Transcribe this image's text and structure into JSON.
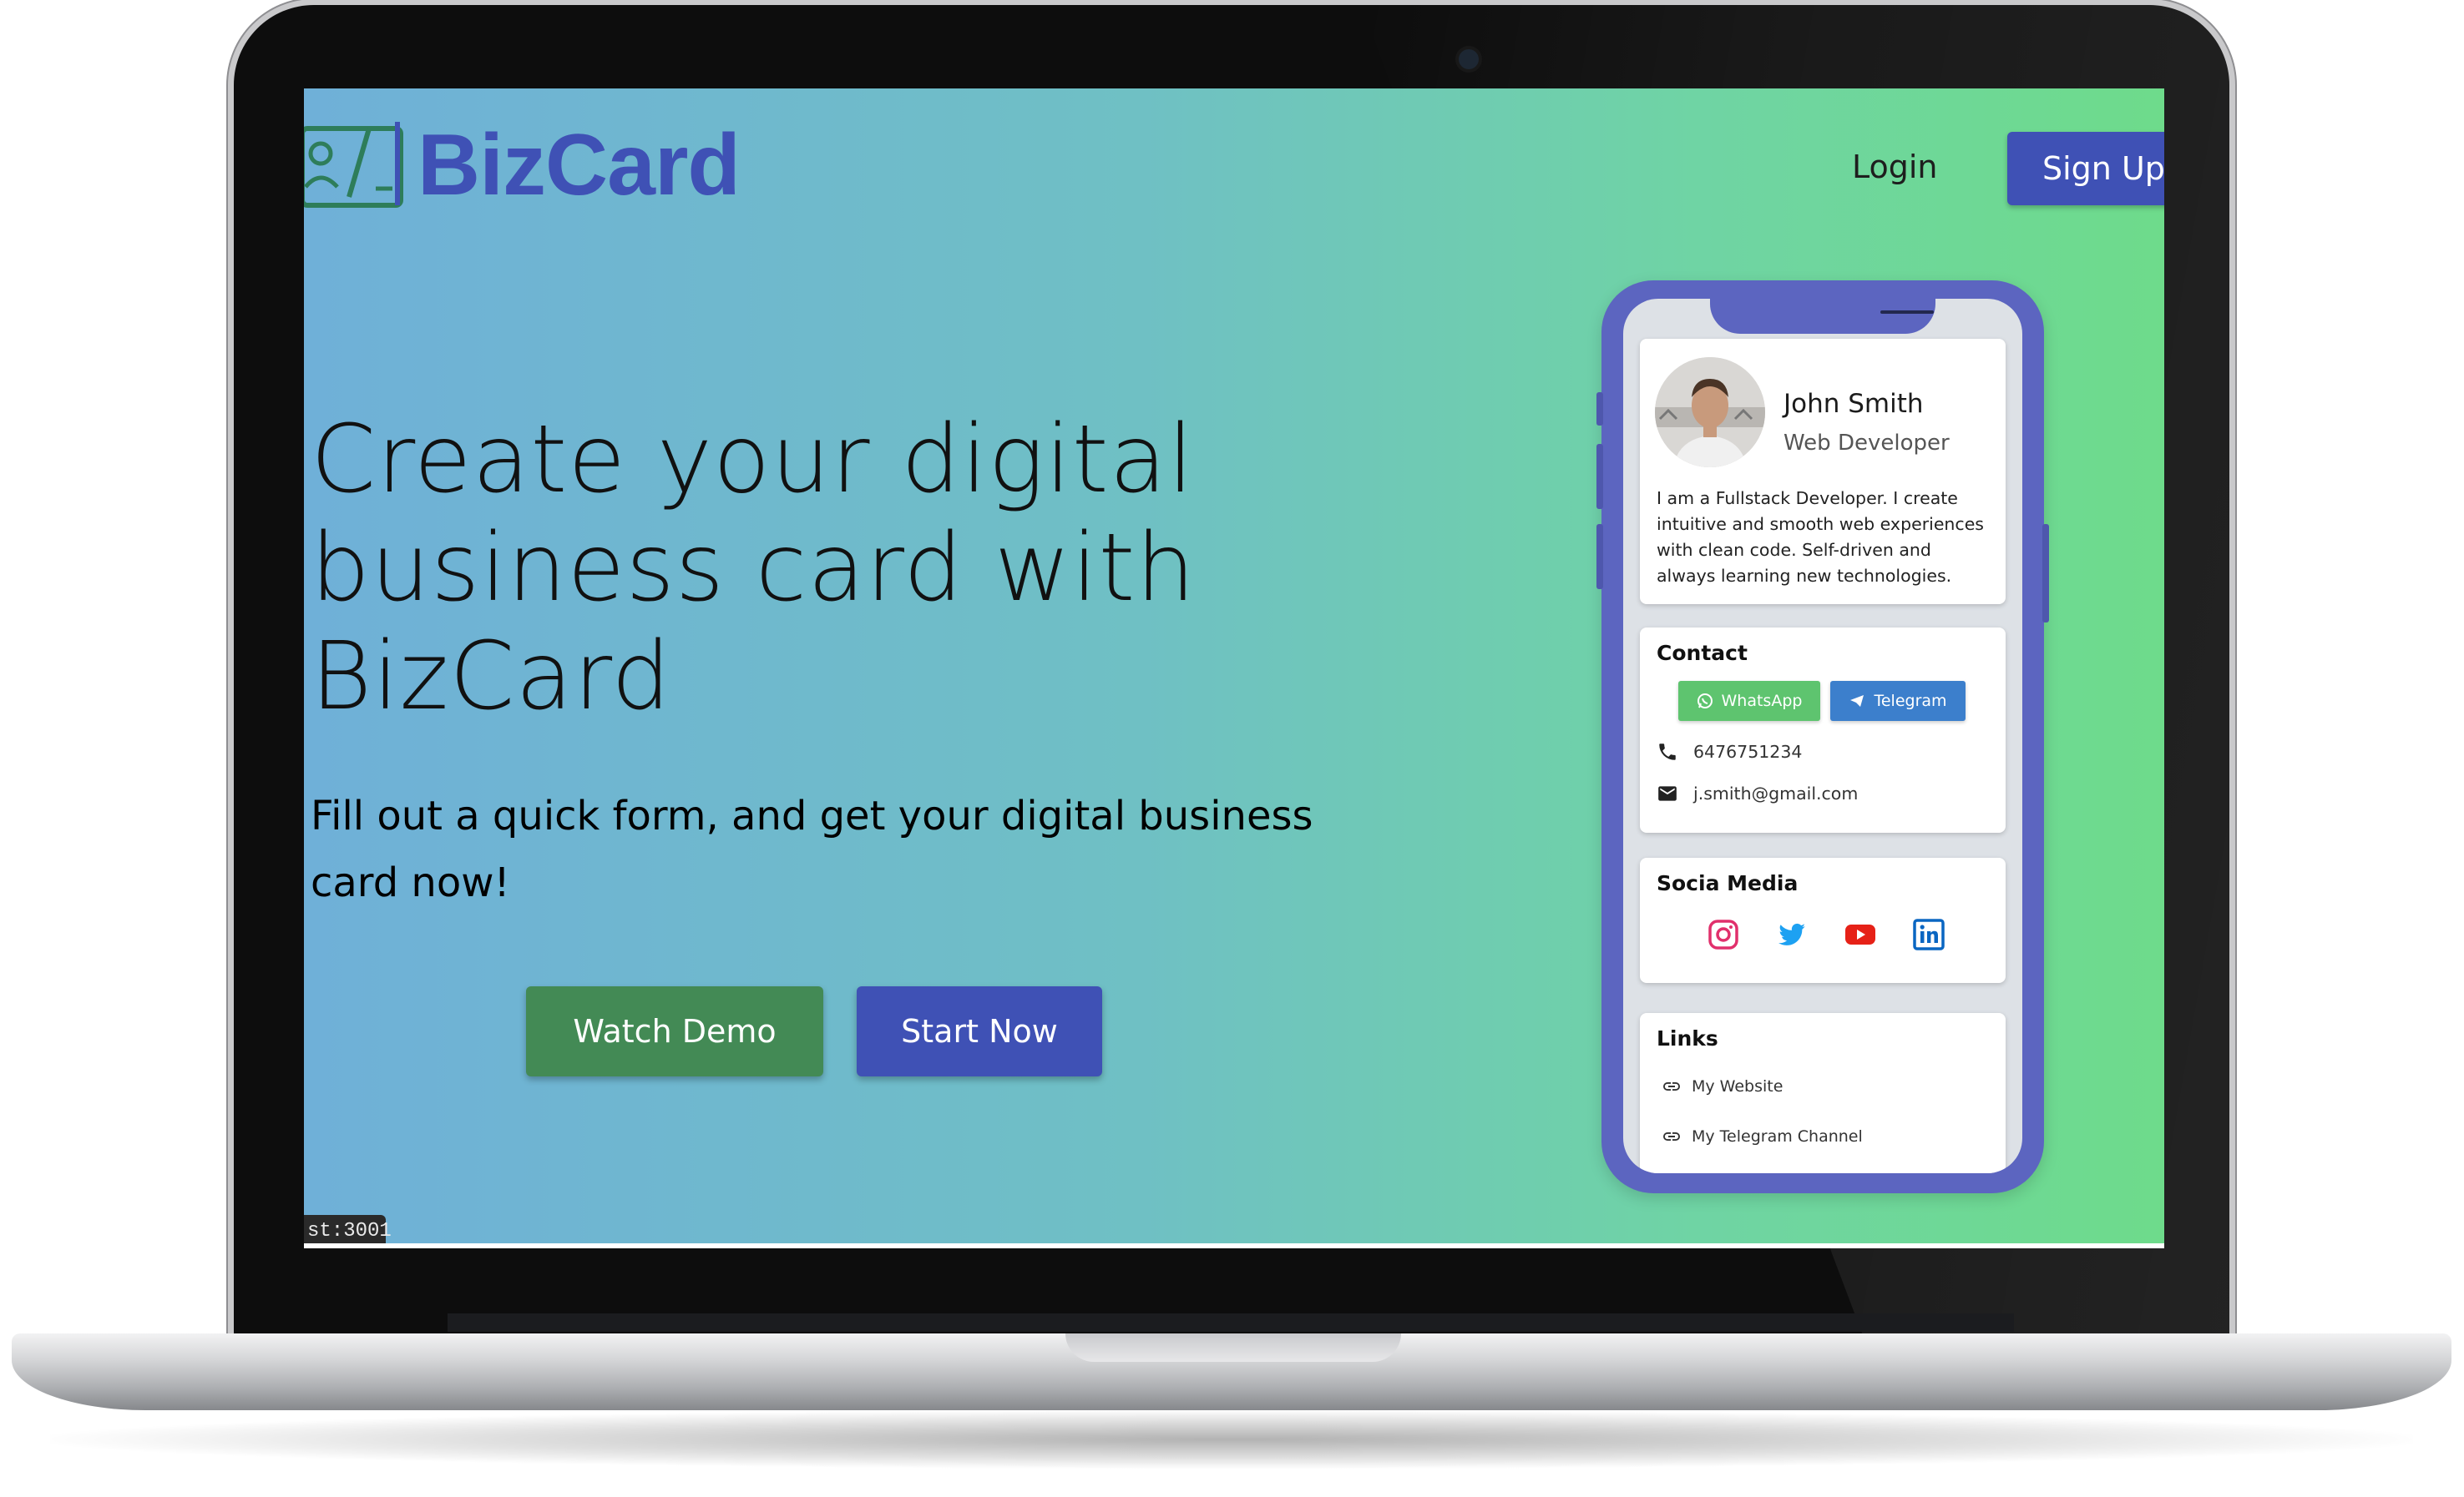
{
  "brand": {
    "name": "BizCard"
  },
  "nav": {
    "login": "Login",
    "signup": "Sign Up"
  },
  "hero": {
    "title_lines": [
      "Create your digital",
      "business card with",
      "BizCard"
    ],
    "subtitle_lines": [
      "Fill out a quick form, and get your digital business",
      "card now!"
    ],
    "watch_demo": "Watch Demo",
    "start_now": "Start Now"
  },
  "status_bar": {
    "url_fragment": "st:3001"
  },
  "phone_card": {
    "profile": {
      "name": "John Smith",
      "role": "Web Developer",
      "bio_lines": [
        "I am a Fullstack Developer. I create",
        "intuitive and smooth web experiences",
        "with clean code. Self-driven and",
        "always learning new technologies."
      ]
    },
    "contact": {
      "title": "Contact",
      "whatsapp": "WhatsApp",
      "telegram": "Telegram",
      "phone": "6476751234",
      "email": "j.smith@gmail.com"
    },
    "social": {
      "title": "Socia Media",
      "icons": [
        "instagram-icon",
        "twitter-icon",
        "youtube-icon",
        "linkedin-icon"
      ]
    },
    "links": {
      "title": "Links",
      "items": [
        "My Website",
        "My Telegram Channel"
      ]
    }
  },
  "colors": {
    "brand_primary": "#3f51b5",
    "demo_button": "#438a55",
    "gradient_left": "#6fb0d8",
    "gradient_right": "#6edb8b",
    "phone_frame": "#5c65c0"
  }
}
